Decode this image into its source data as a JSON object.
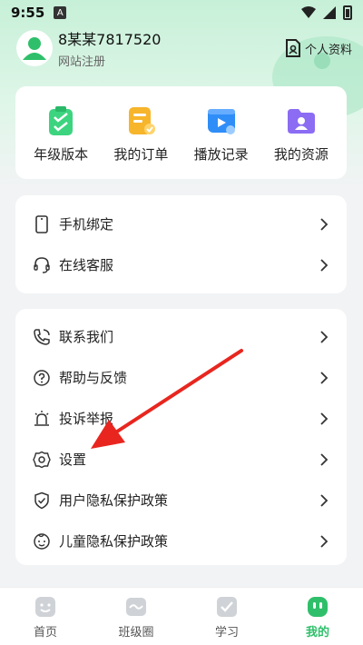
{
  "status_bar": {
    "time": "9:55",
    "badge": "A"
  },
  "profile": {
    "username": "8某某7817520",
    "subtitle": "网站注册",
    "link_label": "个人资料"
  },
  "grid": [
    {
      "label": "年级版本",
      "icon": "clipboard-check-icon",
      "color": "#3dd47f"
    },
    {
      "label": "我的订单",
      "icon": "order-list-icon",
      "color": "#f7b52c"
    },
    {
      "label": "播放记录",
      "icon": "video-play-icon",
      "color": "#2f8df7"
    },
    {
      "label": "我的资源",
      "icon": "folder-user-icon",
      "color": "#8b6cf3"
    }
  ],
  "list1": [
    {
      "label": "手机绑定",
      "icon": "phone-icon"
    },
    {
      "label": "在线客服",
      "icon": "headset-icon"
    }
  ],
  "list2": [
    {
      "label": "联系我们",
      "icon": "phone-call-icon"
    },
    {
      "label": "帮助与反馈",
      "icon": "help-icon"
    },
    {
      "label": "投诉举报",
      "icon": "alarm-icon"
    },
    {
      "label": "设置",
      "icon": "settings-gear-icon"
    },
    {
      "label": "用户隐私保护政策",
      "icon": "shield-check-icon"
    },
    {
      "label": "儿童隐私保护政策",
      "icon": "child-face-icon"
    }
  ],
  "tabbar": [
    {
      "label": "首页",
      "icon": "home-icon",
      "active": false
    },
    {
      "label": "班级圈",
      "icon": "class-circle-icon",
      "active": false
    },
    {
      "label": "学习",
      "icon": "study-icon",
      "active": false
    },
    {
      "label": "我的",
      "icon": "mine-icon",
      "active": true
    }
  ],
  "colors": {
    "accent": "#2fbf6a",
    "annotation_arrow": "#e8261f"
  }
}
